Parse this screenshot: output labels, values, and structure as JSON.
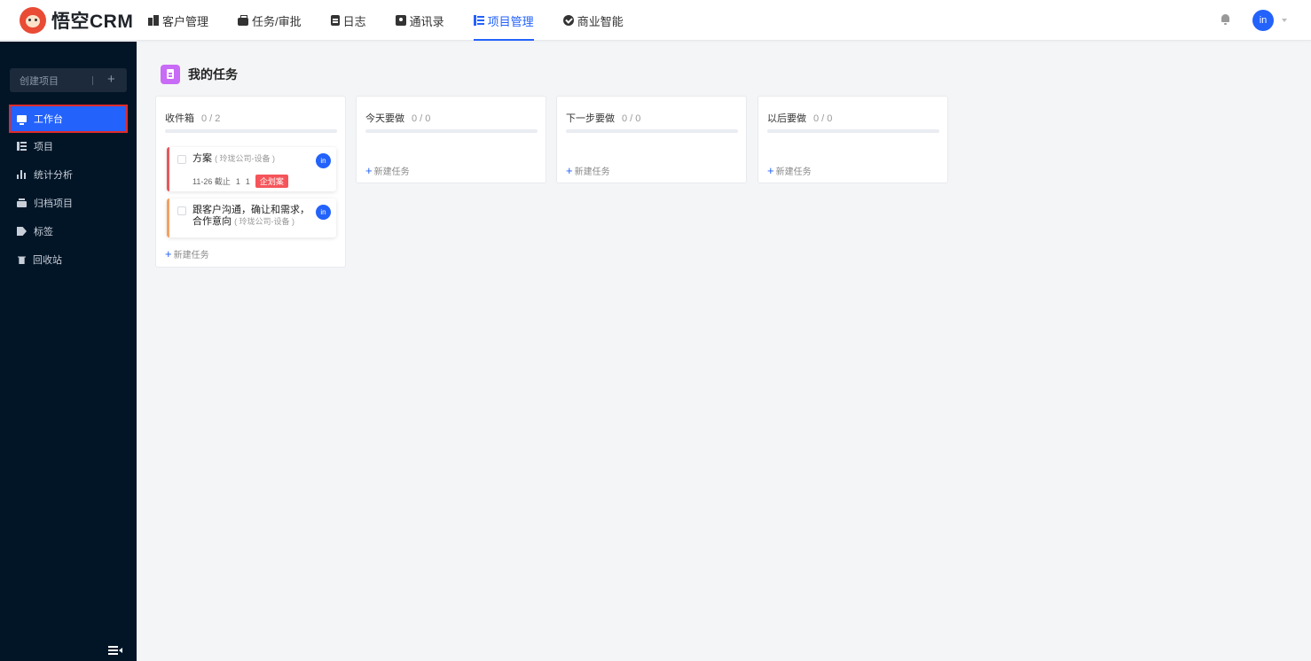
{
  "app": {
    "brand": "悟空CRM"
  },
  "nav": {
    "items": [
      {
        "label": "客户管理",
        "icon": "building-icon"
      },
      {
        "label": "任务/审批",
        "icon": "briefcase-icon"
      },
      {
        "label": "日志",
        "icon": "log-icon"
      },
      {
        "label": "通讯录",
        "icon": "contacts-icon"
      },
      {
        "label": "项目管理",
        "icon": "project-icon",
        "active": true
      },
      {
        "label": "商业智能",
        "icon": "bi-icon"
      }
    ]
  },
  "user": {
    "avatar_text": "in"
  },
  "sidebar": {
    "create_label": "创建项目",
    "create_plus": "+",
    "items": [
      {
        "label": "工作台",
        "icon": "monitor-icon",
        "active": true
      },
      {
        "label": "项目",
        "icon": "list-icon"
      },
      {
        "label": "统计分析",
        "icon": "bar-chart-icon"
      },
      {
        "label": "归档项目",
        "icon": "archive-icon"
      },
      {
        "label": "标签",
        "icon": "tag-icon"
      },
      {
        "label": "回收站",
        "icon": "trash-icon"
      }
    ]
  },
  "main": {
    "title": "我的任务",
    "new_task_label": "新建任务",
    "columns": [
      {
        "name": "收件箱",
        "count": "0 / 2",
        "tasks": [
          {
            "title": "方案",
            "sub": "( 玲珑公司-设备 )",
            "date": "11-26 截止",
            "n1": "1",
            "n2": "1",
            "tag": "企划案",
            "avatar": "in",
            "strip_color": "#e6585c"
          },
          {
            "title": "跟客户沟通，确让和需求，合作意向",
            "sub": "( 玲珑公司-设备 )",
            "avatar": "in",
            "strip_color": "#f5a061"
          }
        ]
      },
      {
        "name": "今天要做",
        "count": "0 / 0",
        "tasks": []
      },
      {
        "name": "下一步要做",
        "count": "0 / 0",
        "tasks": []
      },
      {
        "name": "以后要做",
        "count": "0 / 0",
        "tasks": []
      }
    ]
  }
}
